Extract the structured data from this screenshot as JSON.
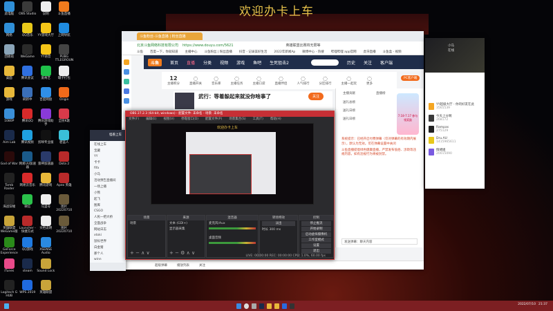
{
  "desktop": {
    "banner": "欢迎办卡上车",
    "icons": [
      {
        "label": "此电脑",
        "color": "#2f8fd8"
      },
      {
        "label": "OBS Studio",
        "color": "#3a3a3a"
      },
      {
        "label": "说明",
        "color": "#eeeeee"
      },
      {
        "label": "斗鱼直播",
        "color": "#f07b1d"
      },
      {
        "label": "网络",
        "color": "#2f8fd8"
      },
      {
        "label": "QQ音乐",
        "color": "#e8c81a"
      },
      {
        "label": "YY游戏大厅",
        "color": "#f5c518"
      },
      {
        "label": "上网导航",
        "color": "#1f8be0"
      },
      {
        "label": "回收站",
        "color": "#8aa4b8"
      },
      {
        "label": "WeGame",
        "color": "#2a2a2a"
      },
      {
        "label": "YY语音",
        "color": "#f5c518"
      },
      {
        "label": "PUBG BATTLEGROUNDS",
        "color": "#444444"
      },
      {
        "label": "桌面",
        "color": "#e8b83a"
      },
      {
        "label": "腾讯会议",
        "color": "#2f6fe0"
      },
      {
        "label": "爱奇艺",
        "color": "#1fc14a"
      },
      {
        "label": "罐子打包",
        "color": "#eeeeee"
      },
      {
        "label": "游戏",
        "color": "#e8b83a"
      },
      {
        "label": "刷新中",
        "color": "#3a6fb8"
      },
      {
        "label": "百度网盘",
        "color": "#2f8fe8"
      },
      {
        "label": "Origin",
        "color": "#f06a1a"
      },
      {
        "label": "1080P",
        "color": "#3a8fd8"
      },
      {
        "label": "腾讯QQ",
        "color": "#d82a2a"
      },
      {
        "label": "腾讯游戏助手",
        "color": "#8a3ad8"
      },
      {
        "label": "全民K歌",
        "color": "#d83a4a"
      },
      {
        "label": "Aim Lab",
        "color": "#1a2a4a"
      },
      {
        "label": "腾讯视频",
        "color": "#1fa0e0"
      },
      {
        "label": "剪映专业版",
        "color": "#111111"
      },
      {
        "label": "碧蓝人",
        "color": "#3ac0d8"
      },
      {
        "label": "God of War",
        "color": "#2a0a0a"
      },
      {
        "label": "网易UU加速器",
        "color": "#1a5a8a"
      },
      {
        "label": "雷神加速器",
        "color": "#2a3a6a"
      },
      {
        "label": "Dota 2",
        "color": "#b82a2a"
      },
      {
        "label": "Tomb Raider",
        "color": "#222222"
      },
      {
        "label": "网易云音乐",
        "color": "#d82a2a"
      },
      {
        "label": "腾讯游戏",
        "color": "#e8b83a"
      },
      {
        "label": "Apex 英雄",
        "color": "#b82a2a"
      },
      {
        "label": "海战穿梭",
        "color": "#222222"
      },
      {
        "label": "微信",
        "color": "#2ac14a"
      },
      {
        "label": "马里号",
        "color": "#eeeeee"
      },
      {
        "label": "图片 20220710",
        "color": "#6a5a3a"
      },
      {
        "label": "英雄联盟 WeGame版",
        "color": "#c8a43a"
      },
      {
        "label": "Launcher - 快捷方式",
        "color": "#b82a2a"
      },
      {
        "label": "文档说明",
        "color": "#eeeeee"
      },
      {
        "label": "图片 20220710",
        "color": "#6a5a3a"
      },
      {
        "label": "GeForce Experience",
        "color": "#2a8a1a"
      },
      {
        "label": "QQ游戏",
        "color": "#1f7ae0"
      },
      {
        "label": "XSENSE Audio",
        "color": "#2a8ae0"
      },
      {
        "label": "",
        "color": "transparent"
      },
      {
        "label": "iTunes",
        "color": "#e84a8a"
      },
      {
        "label": "steam",
        "color": "#1a2a4a"
      },
      {
        "label": "Sound Lock",
        "color": "#c8a43a"
      },
      {
        "label": "",
        "color": "transparent"
      },
      {
        "label": "Logitech G HUB",
        "color": "#222222"
      },
      {
        "label": "WPS 2019",
        "color": "#1f6ae0"
      },
      {
        "label": "英雄联盟",
        "color": "#c8a43a"
      },
      {
        "label": "",
        "color": "transparent"
      }
    ]
  },
  "browser": {
    "tab": "斗鱼粉丝-斗鱼直播 | 粉丝直播",
    "company": "北京斗鱼网络科技有限公司",
    "url": "https://www.douyu.com/5621",
    "search_hint": "英雄联盟比赛将无限等",
    "bookmarks": [
      "斗鱼",
      "百度一下，你就知道",
      "主播中心",
      "斗鱼粉丝 | 粉丝直播",
      "抖音 - 记录美好生活",
      "2022年新闻Ap",
      "微博中心 - 热搜",
      "哔哩哔哩 app官网",
      "虎牙直播",
      "斗鱼盒 - 视频"
    ],
    "nav": {
      "logo": "斗鱼",
      "items": [
        "首页",
        "直播",
        "分类",
        "视频",
        "游戏",
        "鱼吧",
        "生死狙击2"
      ],
      "active": 1,
      "right": [
        "历史",
        "关注",
        "客户端"
      ]
    },
    "toolbar": [
      {
        "big": "12",
        "label": "主播积分"
      },
      {
        "label": "直播开关"
      },
      {
        "label": "音乐库"
      },
      {
        "label": "主播任务"
      },
      {
        "label": "主播口袋"
      },
      {
        "label": "直播伴侣"
      },
      {
        "label": "人气排行"
      },
      {
        "label": "分区排行"
      },
      {
        "label": "主播一起玩"
      },
      {
        "label": "更多"
      }
    ],
    "pc_button": "PC客户端",
    "streamer_title": "武行：等着躲起来就没你啥事了",
    "follow": "关注",
    "chat": {
      "tabs": [
        "主播贡献",
        "直播榜"
      ],
      "ranks": [
        "送礼总榜",
        "送礼日榜",
        "送礼日榜"
      ],
      "system_msg": "系统提示：已经开启付费弹幕（仅对弹幕的有效期内展示），默认为无效。可在弹幕设置中关闭",
      "notice": "斗鱼直播提倡绿色健康直播，严禁发布低俗、涉政等违规内容，如有违规行为将被封禁。",
      "input": "发送弹幕：聊天内容"
    },
    "promo": "7.18-7.17 参与领奖励",
    "bottom": [
      "超级弹幕",
      "播放列表",
      "关注"
    ]
  },
  "obs": {
    "title": "OBS 27.2.3 (64-bit, windows) - 配置文件: 未命名 - 场景: 未命名",
    "menu": [
      "文件(F)",
      "编辑(E)",
      "视图(V)",
      "停靠窗口(D)",
      "配置文件(P)",
      "场景集合(S)",
      "工具(T)",
      "帮助(H)"
    ],
    "preview_title": "欢迎办卡上车",
    "docks": {
      "scenes": "场景",
      "sources": "来源",
      "mixer": "混音器",
      "transitions": "转场特效",
      "controls": "控制"
    },
    "scene_items": [
      "场景"
    ],
    "source_items": [
      "文本 (GDI+)",
      "显示器采集"
    ],
    "mixer": [
      "麦克风/Aux",
      "桌面音频"
    ],
    "transition": "淡出",
    "duration_label": "时长",
    "duration": "300 ms",
    "controls": [
      "停止推流",
      "开始录制",
      "启动虚拟摄像机",
      "工作室模式",
      "设置",
      "退出"
    ],
    "status": "LIVE: 00:00:00   REC: 00:00:00   CPU: 1.0%, 60.00 fps"
  },
  "qq_group": {
    "title": "怪兽上车",
    "items": [
      "在线上车",
      "宝藏",
      "YY",
      "卡卡",
      "fifa",
      "小马",
      "活动预告直播间",
      "一场上播",
      "小熊",
      "起飞",
      "图库",
      "CSGO",
      "人民一把大桥",
      "全面战争",
      "网站日志",
      "xtoki",
      "鼠标世界",
      "白金猪",
      "那个人",
      "winn"
    ]
  },
  "qq": {
    "name": "小马",
    "status": "在线",
    "friends": [
      {
        "name": "YY超级大厅 - 你的好友在此",
        "id": "3565539"
      },
      {
        "name": "今天上分啊",
        "id": "268172"
      },
      {
        "name": "Rampas",
        "id": "275129"
      },
      {
        "name": "Dru.AU",
        "id": "1415965611"
      },
      {
        "name": "情绪姐",
        "id": "20015090"
      }
    ]
  },
  "taskbar": {
    "time": "21:37",
    "date": "2022/07/10"
  }
}
